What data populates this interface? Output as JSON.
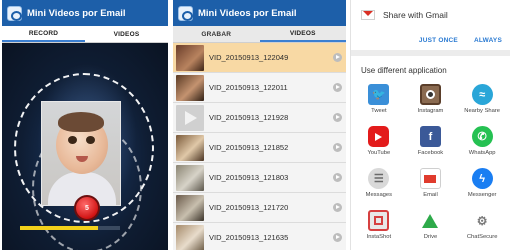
{
  "panels": {
    "record": {
      "app_title": "Mini Videos por Email",
      "tabs": [
        "RECORD",
        "VIDEOS"
      ],
      "record_button_label": "5",
      "progress": 0.78
    },
    "videos": {
      "app_title": "Mini Videos por Email",
      "tabs": [
        "GRABAR",
        "VIDEOS"
      ],
      "items": [
        "VID_20150913_122049",
        "VID_20150913_122011",
        "VID_20150913_121928",
        "VID_20150913_121852",
        "VID_20150913_121803",
        "VID_20150913_121720",
        "VID_20150913_121635"
      ]
    },
    "share": {
      "title": "Share with Gmail",
      "just_once": "JUST ONCE",
      "always": "ALWAYS",
      "different_app_heading": "Use different application",
      "apps": [
        {
          "label": "Tweet",
          "icon": "twitter-icon",
          "glyph": "🐦"
        },
        {
          "label": "Instagram",
          "icon": "instagram-icon",
          "glyph": ""
        },
        {
          "label": "Nearby Share",
          "icon": "nearby-share-icon",
          "glyph": "≈"
        },
        {
          "label": "YouTube",
          "icon": "youtube-icon",
          "glyph": ""
        },
        {
          "label": "Facebook",
          "icon": "facebook-icon",
          "glyph": "f"
        },
        {
          "label": "WhatsApp",
          "icon": "whatsapp-icon",
          "glyph": "✆"
        },
        {
          "label": "Messages",
          "icon": "messages-icon",
          "glyph": "☰"
        },
        {
          "label": "Email",
          "icon": "email-icon",
          "glyph": ""
        },
        {
          "label": "Messenger",
          "icon": "messenger-icon",
          "glyph": "ϟ"
        },
        {
          "label": "InstaShot",
          "icon": "instashot-icon",
          "glyph": ""
        },
        {
          "label": "Drive",
          "icon": "drive-icon",
          "glyph": ""
        },
        {
          "label": "ChatSecure",
          "icon": "chatsecure-icon",
          "glyph": "⚙"
        }
      ]
    }
  },
  "colors": {
    "appbar": "#1d5fa9",
    "selected_row": "#f8d9a4",
    "accent_link": "#2a7ad2",
    "record_red": "#d11414",
    "progress_yellow": "#f3d11b"
  }
}
